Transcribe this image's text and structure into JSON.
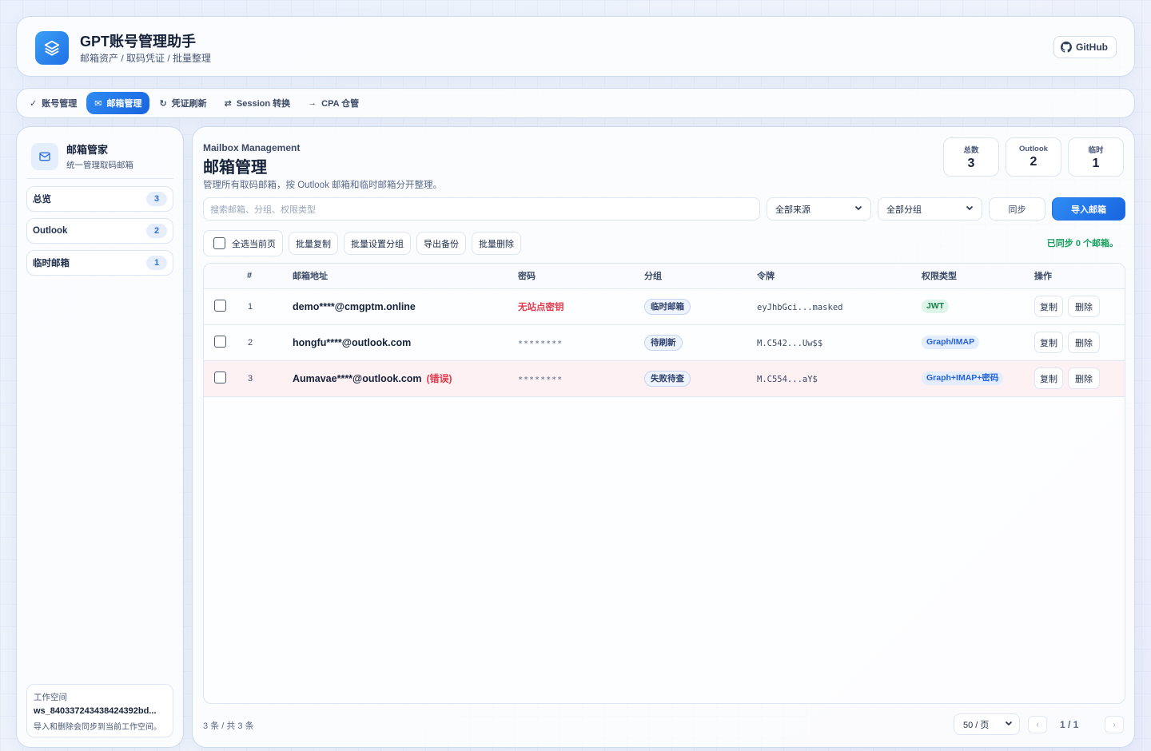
{
  "header": {
    "title": "GPT账号管理助手",
    "subtitle": "邮箱资产 / 取码凭证 / 批量整理",
    "github_label": "GitHub"
  },
  "nav": {
    "items": [
      {
        "icon": "✓",
        "label": "账号管理"
      },
      {
        "icon": "✉",
        "label": "邮箱管理",
        "active": true
      },
      {
        "icon": "↻",
        "label": "凭证刷新"
      },
      {
        "icon": "⇄",
        "label": "Session 转换"
      },
      {
        "icon": "→",
        "label": "CPA 仓管"
      }
    ]
  },
  "sidebar": {
    "title": "邮箱管家",
    "subtitle": "统一管理取码邮箱",
    "items": [
      {
        "label": "总览",
        "count": "3"
      },
      {
        "label": "Outlook",
        "count": "2"
      },
      {
        "label": "临时邮箱",
        "count": "1"
      }
    ],
    "workspace": {
      "label": "工作空间",
      "id": "ws_840337243438424392bd...",
      "note": "导入和删除会同步到当前工作空间。"
    }
  },
  "main": {
    "title_en": "Mailbox Management",
    "title": "邮箱管理",
    "description": "管理所有取码邮箱，按 Outlook 邮箱和临时邮箱分开整理。",
    "stats": [
      {
        "label": "总数",
        "value": "3"
      },
      {
        "label": "Outlook",
        "value": "2"
      },
      {
        "label": "临时",
        "value": "1"
      }
    ],
    "search_placeholder": "搜索邮箱、分组、权限类型",
    "source_select": "全部来源",
    "group_select": "全部分组",
    "sync_button": "同步",
    "import_button": "导入邮箱",
    "toolbar": {
      "select_page": "全选当前页",
      "batch_copy": "批量复制",
      "batch_group": "批量设置分组",
      "export_backup": "导出备份",
      "batch_delete": "批量删除"
    },
    "sync_status": "已同步 0 个邮箱。",
    "table": {
      "headers": {
        "num": "#",
        "email": "邮箱地址",
        "password": "密码",
        "group": "分组",
        "token": "令牌",
        "perm": "权限类型",
        "ops": "操作"
      },
      "rows": [
        {
          "num": "1",
          "email": "demo****@cmgptm.online",
          "error": "",
          "password": "无站点密钥",
          "group": "临时邮箱",
          "token": "eyJhbGci...masked",
          "perm": "JWT",
          "copy": "复制",
          "delete": "删除"
        },
        {
          "num": "2",
          "email": "hongfu****@outlook.com",
          "error": "",
          "password": "********",
          "group": "待刷新",
          "token": "M.C542...Uw$$",
          "perm": "Graph/IMAP",
          "copy": "复制",
          "delete": "删除"
        },
        {
          "num": "3",
          "email": "Aumavae****@outlook.com",
          "error": "(错误)",
          "password": "********",
          "group": "失败待查",
          "token": "M.C554...aY$",
          "perm": "Graph+IMAP+密码",
          "copy": "复制",
          "delete": "删除"
        }
      ]
    },
    "footer": {
      "count": "3 条 / 共 3 条",
      "page_size": "50 / 页",
      "page_info": "1 / 1",
      "prev": "‹",
      "next": "›"
    }
  }
}
